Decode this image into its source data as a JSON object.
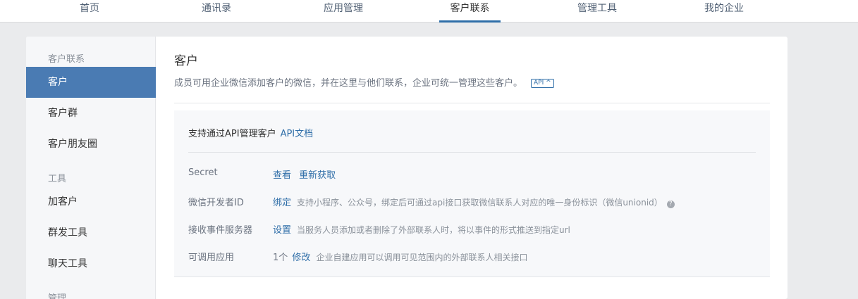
{
  "topnav": {
    "tabs": [
      {
        "label": "首页"
      },
      {
        "label": "通讯录"
      },
      {
        "label": "应用管理"
      },
      {
        "label": "客户联系"
      },
      {
        "label": "管理工具"
      },
      {
        "label": "我的企业"
      }
    ],
    "active_tab": "客户联系"
  },
  "sidebar": {
    "group_customer": "客户联系",
    "items_customer": [
      {
        "label": "客户"
      },
      {
        "label": "客户群"
      },
      {
        "label": "客户朋友圈"
      }
    ],
    "group_tools": "工具",
    "items_tools": [
      {
        "label": "加客户"
      },
      {
        "label": "群发工具"
      },
      {
        "label": "聊天工具"
      }
    ],
    "group_manage": "管理",
    "active_item": "客户"
  },
  "main": {
    "title": "客户",
    "description": "成员可用企业微信添加客户的微信，并在这里与他们联系，企业可统一管理这些客户。",
    "api_badge": "API ^"
  },
  "api_box": {
    "heading": "支持通过API管理客户",
    "doc_link": "API文档",
    "rows": [
      {
        "label": "Secret",
        "links": [
          "查看",
          "重新获取"
        ]
      },
      {
        "label": "微信开发者ID",
        "link": "绑定",
        "hint": "支持小程序、公众号，绑定后可通过api接口获取微信联系人对应的唯一身份标识（微信unionid）"
      },
      {
        "label": "接收事件服务器",
        "link": "设置",
        "hint": "当服务人员添加或者删除了外部联系人时，将以事件的形式推送到指定url"
      },
      {
        "label": "可调用应用",
        "count": "1个",
        "link": "修改",
        "hint": "企业自建应用可以调用可见范围内的外部联系人相关接口"
      }
    ]
  },
  "colors": {
    "accent": "#2f6ea8",
    "sidebar_active": "#4a7bb3"
  },
  "icons": {
    "help": "question-circle-icon"
  }
}
